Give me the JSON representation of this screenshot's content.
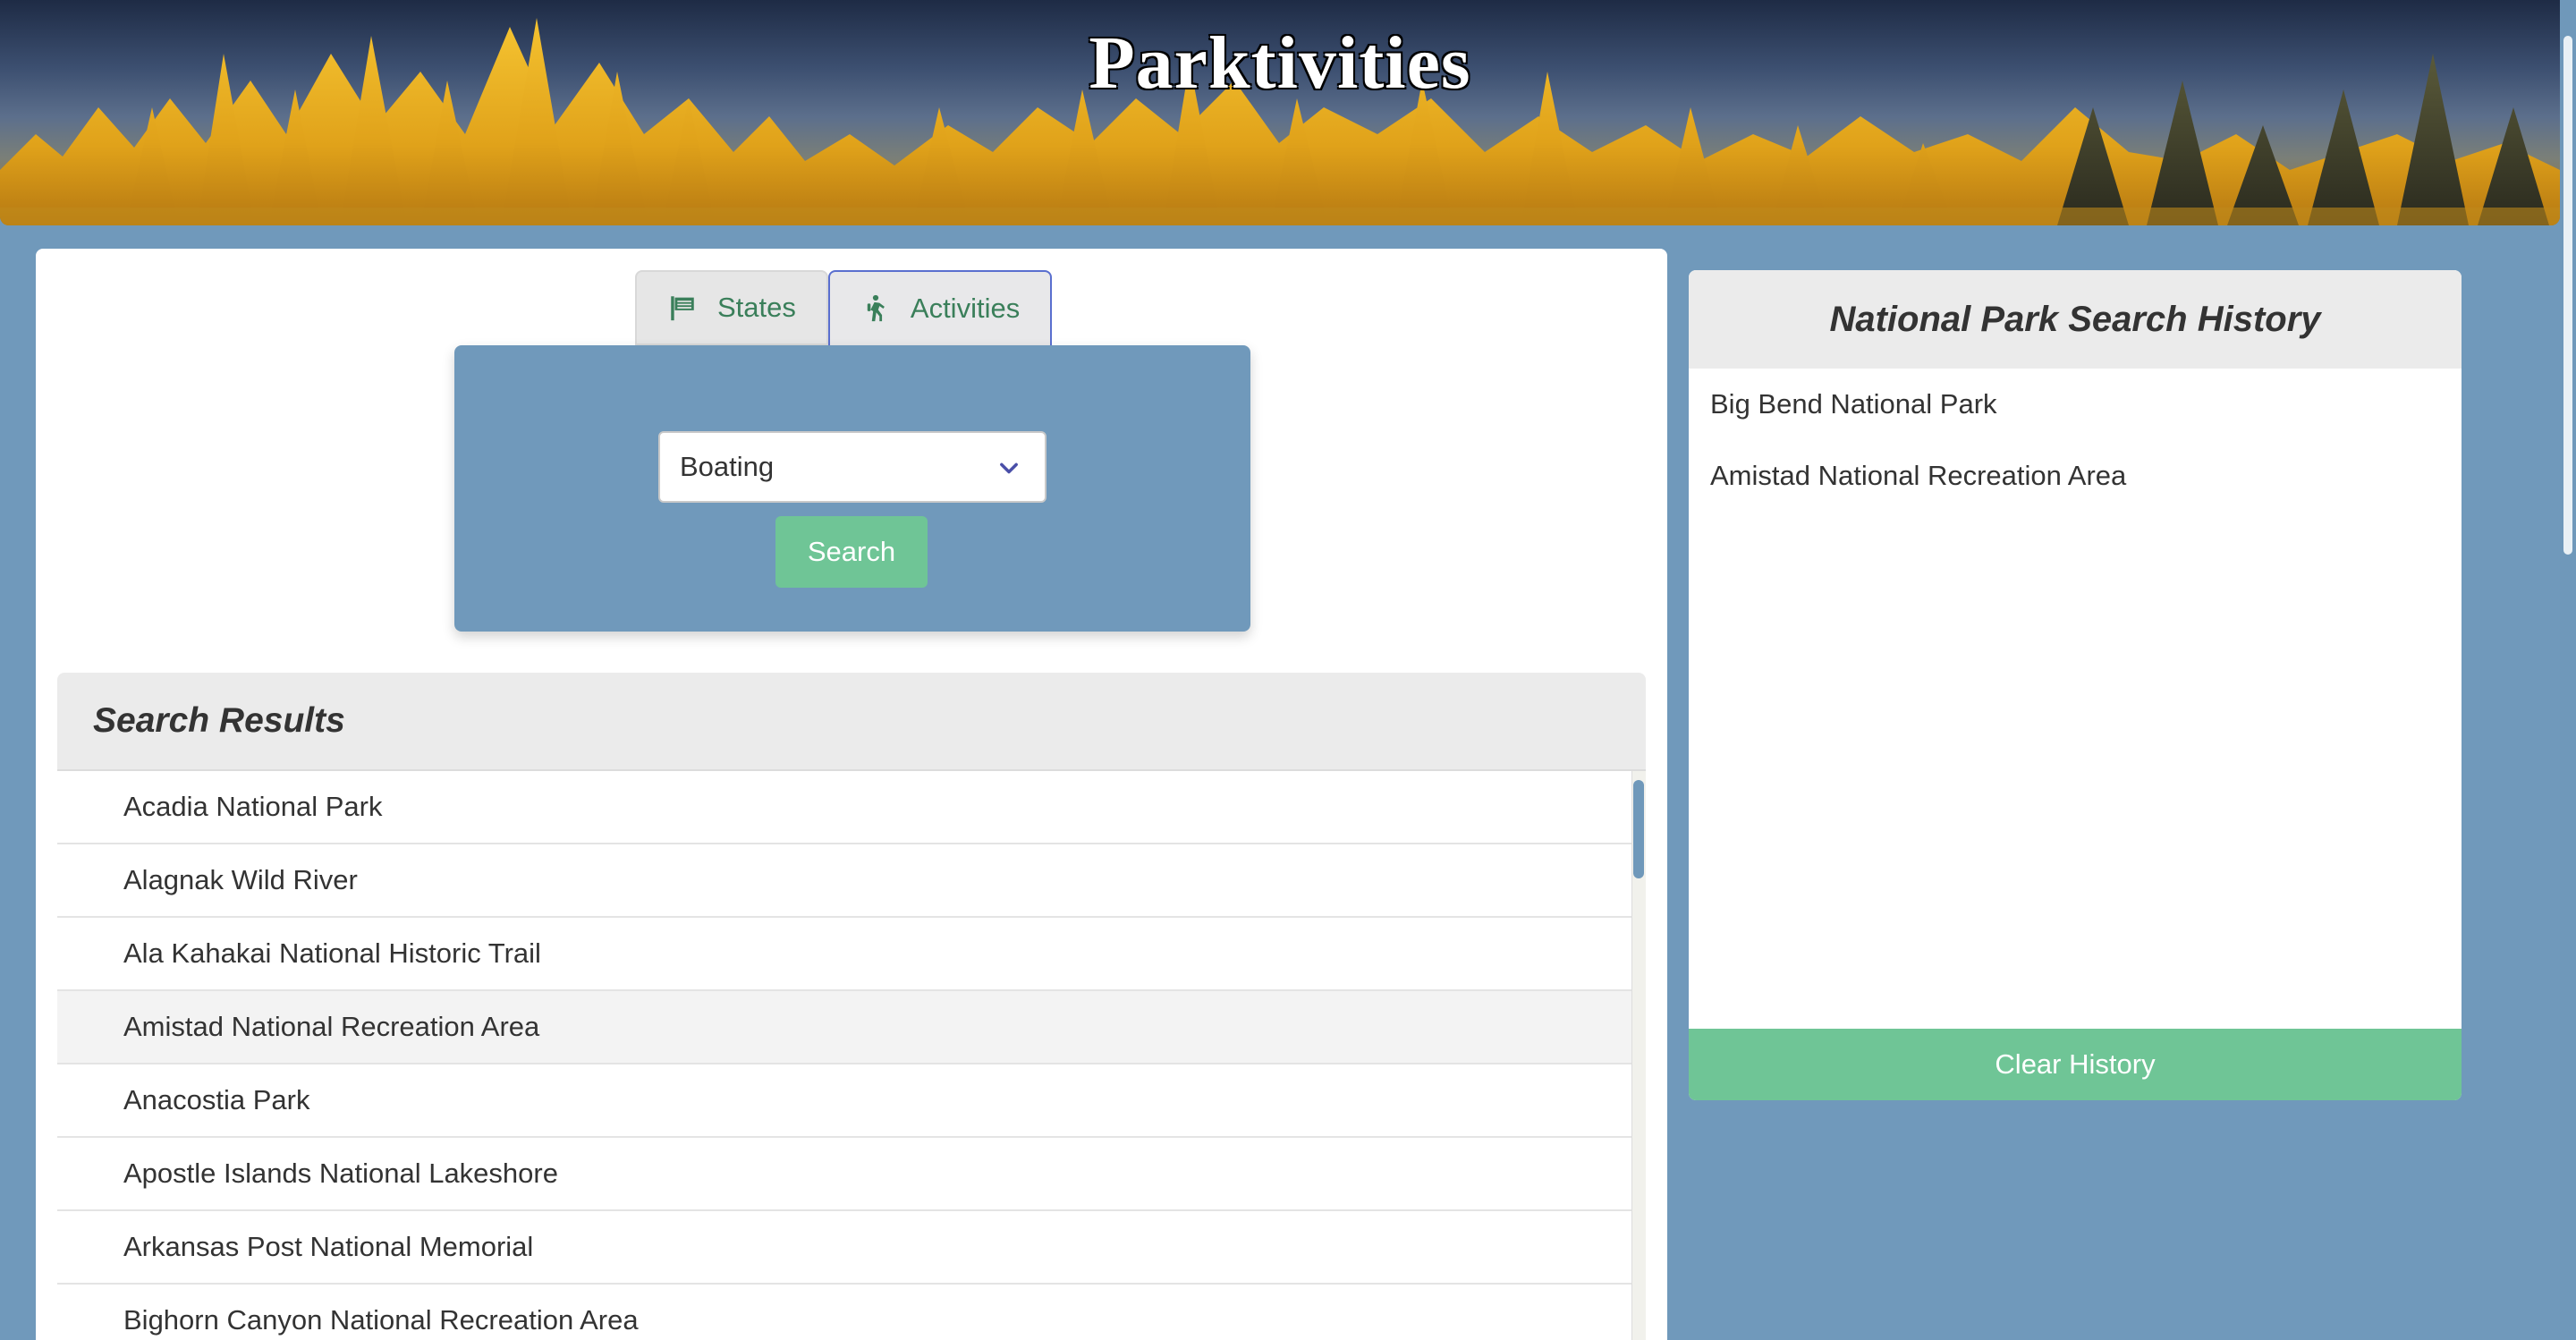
{
  "header": {
    "title": "Parktivities"
  },
  "tabs": [
    {
      "label": "States",
      "icon": "flag-icon"
    },
    {
      "label": "Activities",
      "icon": "hiking-icon",
      "active": true
    }
  ],
  "search": {
    "selected_activity": "Boating",
    "button_label": "Search"
  },
  "results": {
    "heading": "Search Results",
    "items": [
      "Acadia National Park",
      "Alagnak Wild River",
      "Ala Kahakai National Historic Trail",
      "Amistad National Recreation Area",
      "Anacostia Park",
      "Apostle Islands National Lakeshore",
      "Arkansas Post National Memorial",
      "Bighorn Canyon National Recreation Area"
    ]
  },
  "history": {
    "heading": "National Park Search History",
    "items": [
      "Big Bend National Park",
      "Amistad National Recreation Area"
    ],
    "clear_label": "Clear History"
  },
  "colors": {
    "page_background": "#7099bb",
    "accent_green": "#6fc596",
    "tab_text": "#3a7f5a",
    "active_tab_border": "#5a6fcf"
  }
}
